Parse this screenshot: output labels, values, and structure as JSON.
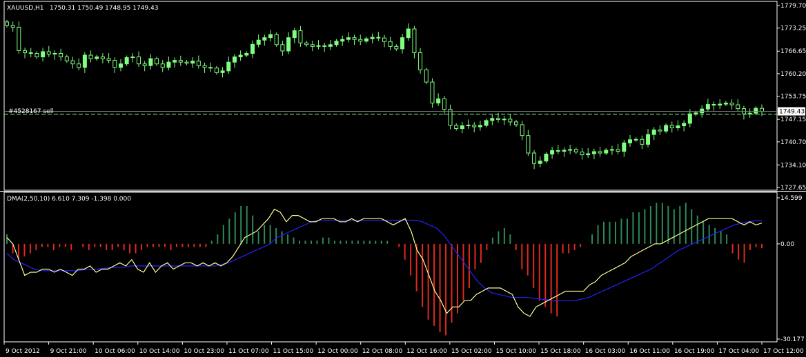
{
  "window": {
    "symbol_label": "XAUUSD,H1",
    "ohlc_text": "1750.31 1750.49 1748.95 1749.43",
    "order_label": "#4528167 sell",
    "current_price_label": "1749.43"
  },
  "indicator": {
    "label": "DMA(2,50,10) 6.610 7.309 -1.398 0.000"
  },
  "colors": {
    "background": "#000000",
    "grid_frame": "#ffffff",
    "bull_candle": "#7fff7f",
    "bear_candle": "#000000",
    "candle_outline": "#7fff7f",
    "order_line": "#7fff7f",
    "histogram_up": "#2e8b57",
    "histogram_down": "#e0281e",
    "dma_line": "#ffff99",
    "signal_line": "#2323ff",
    "text": "#ffffff"
  },
  "chart_data": [
    {
      "type": "candlestick",
      "title": "XAUUSD,H1",
      "price_axis_ticks": [
        "1779.70",
        "1773.25",
        "1766.65",
        "1760.20",
        "1753.75",
        "1747.15",
        "1740.70",
        "1734.10",
        "1727.65"
      ],
      "ylim": [
        1727.65,
        1779.7
      ],
      "time_labels": [
        "9 Oct 2012",
        "9 Oct 21:00",
        "10 Oct 06:00",
        "10 Oct 14:00",
        "10 Oct 23:00",
        "11 Oct 07:00",
        "11 Oct 15:00",
        "12 Oct 00:00",
        "12 Oct 08:00",
        "12 Oct 16:00",
        "15 Oct 02:00",
        "15 Oct 10:00",
        "15 Oct 18:00",
        "16 Oct 03:00",
        "16 Oct 11:00",
        "16 Oct 19:00",
        "17 Oct 04:00",
        "17 Oct 12:00"
      ],
      "order_line_price": 1748.6,
      "current_price": 1749.43,
      "close_series": [
        1774.0,
        1773.5,
        1766.8,
        1766.2,
        1766.0,
        1765.0,
        1766.5,
        1765.8,
        1766.0,
        1765.0,
        1763.9,
        1763.0,
        1762.0,
        1765.5,
        1764.5,
        1765.0,
        1764.5,
        1764.0,
        1762.0,
        1763.0,
        1764.8,
        1765.0,
        1763.0,
        1762.5,
        1764.5,
        1763.0,
        1762.0,
        1763.5,
        1764.0,
        1763.5,
        1763.2,
        1763.8,
        1762.5,
        1762.0,
        1761.8,
        1760.5,
        1761.0,
        1763.5,
        1765.0,
        1765.5,
        1766.0,
        1768.6,
        1769.8,
        1770.5,
        1771.4,
        1768.5,
        1766.7,
        1770.5,
        1772.5,
        1769.0,
        1768.5,
        1768.0,
        1768.2,
        1768.0,
        1768.5,
        1769.5,
        1770.0,
        1770.5,
        1770.0,
        1769.5,
        1770.2,
        1770.6,
        1770.4,
        1769.4,
        1768.0,
        1767.3,
        1770.5,
        1773.0,
        1766.2,
        1761.3,
        1757.8,
        1751.8,
        1753.0,
        1750.0,
        1745.4,
        1744.5,
        1745.3,
        1745.5,
        1745.0,
        1745.4,
        1746.8,
        1747.4,
        1747.1,
        1747.2,
        1746.4,
        1745.6,
        1742.5,
        1737.5,
        1734.5,
        1735.2,
        1737.2,
        1738.2,
        1738.0,
        1738.3,
        1738.5,
        1737.8,
        1737.0,
        1737.3,
        1737.9,
        1737.5,
        1738.3,
        1738.5,
        1738.0,
        1740.4,
        1741.3,
        1741.4,
        1740.0,
        1742.8,
        1744.1,
        1743.8,
        1745.4,
        1744.7,
        1745.3,
        1746.0,
        1748.7,
        1749.0,
        1750.1,
        1751.4,
        1751.2,
        1751.5,
        1751.8,
        1751.3,
        1750.2,
        1748.7,
        1748.9,
        1750.3,
        1749.43
      ]
    },
    {
      "type": "line",
      "title": "DMA(2,50,10) 6.610 7.309 -1.398 0.000",
      "indicator_axis_ticks": [
        "14.599",
        "0.00",
        "-30.177"
      ],
      "ylim": [
        -30.177,
        14.599
      ],
      "series": [
        {
          "name": "DMA",
          "values": [
            2,
            0,
            -5,
            -10,
            -9,
            -9,
            -8,
            -8,
            -9,
            -8,
            -9,
            -10,
            -8,
            -8,
            -7,
            -9,
            -8,
            -8,
            -7,
            -6,
            -7,
            -5,
            -8,
            -9,
            -6,
            -9,
            -7,
            -6,
            -8,
            -7,
            -6,
            -6,
            -7,
            -6,
            -7,
            -6,
            -7,
            -6,
            -4,
            -1,
            2,
            3,
            4,
            6,
            8,
            11,
            10,
            7,
            9,
            9,
            8,
            7,
            7,
            8,
            8,
            8,
            7,
            7,
            8,
            7,
            8,
            8,
            8,
            8,
            7,
            6,
            7,
            8,
            4,
            -2,
            -5,
            -10,
            -15,
            -18,
            -22,
            -20,
            -20,
            -18,
            -18,
            -16,
            -15,
            -14,
            -14,
            -14,
            -15,
            -16,
            -20,
            -22,
            -23,
            -20,
            -19,
            -18,
            -17,
            -16,
            -15,
            -15,
            -15,
            -15,
            -13,
            -12,
            -10,
            -9,
            -8,
            -7,
            -6,
            -4,
            -3,
            -2,
            -1,
            0,
            0,
            1,
            2,
            3,
            4,
            5,
            6,
            7,
            8,
            8,
            8,
            8,
            8,
            7,
            6,
            7,
            6,
            6.61
          ]
        },
        {
          "name": "Signal",
          "values": [
            -3,
            -5,
            -6,
            -7,
            -8,
            -8.5,
            -8.5,
            -8.5,
            -8.5,
            -8.5,
            -8.5,
            -8.3,
            -8,
            -8,
            -7.8,
            -7.5,
            -7.5,
            -7.3,
            -7,
            -7,
            -7,
            -7,
            -7,
            -7,
            -7,
            -7,
            -7,
            -7,
            -7,
            -7,
            -7,
            -6.5,
            -6,
            -5,
            -4,
            -3,
            -2,
            -1,
            0,
            2,
            3,
            4,
            5,
            6,
            7,
            7.5,
            7.5,
            7.5,
            7.5,
            7.5,
            7.5,
            7.5,
            7.5,
            7.5,
            7.5,
            7.5,
            7.5,
            7.5,
            7.5,
            7.5,
            7,
            6,
            5,
            3,
            0,
            -3,
            -6,
            -9,
            -12,
            -14,
            -15.5,
            -16,
            -16.5,
            -17,
            -17,
            -17,
            -17.2,
            -17.5,
            -17.7,
            -18,
            -18,
            -18,
            -18,
            -17.5,
            -17,
            -16,
            -15,
            -14,
            -13,
            -12,
            -11,
            -10,
            -9,
            -8,
            -6.5,
            -5,
            -3.5,
            -2,
            -1,
            0,
            1,
            2,
            3,
            4,
            5,
            6,
            6.5,
            7,
            7.3,
            7.309
          ]
        },
        {
          "name": "Histogram",
          "values": [
            3,
            -3,
            -5,
            -4,
            -3,
            -2,
            -1,
            -1,
            -2,
            -1,
            -1,
            -2,
            0,
            -1,
            -2,
            -1,
            -1,
            -2,
            -2,
            -1,
            -2,
            -3,
            -3,
            -2,
            -1,
            -1,
            -1,
            -1,
            -2,
            -1,
            -1,
            -1,
            -1,
            -1,
            -1,
            1,
            3,
            6,
            8,
            10,
            12,
            12,
            9,
            4,
            6,
            6,
            5,
            4,
            3,
            2,
            1,
            1,
            1,
            1,
            2,
            2,
            1,
            1,
            1,
            1,
            1,
            1,
            1,
            1,
            1,
            1,
            0,
            -1,
            -5,
            -10,
            -15,
            -20,
            -24,
            -26,
            -28,
            -29,
            -25,
            -22,
            -18,
            -14,
            -8,
            -6,
            -2,
            2,
            4,
            5,
            3,
            -2,
            -8,
            -10,
            -14,
            -18,
            -20,
            -22,
            -23,
            -3,
            -3,
            -2,
            -1,
            0,
            3,
            6,
            7,
            7,
            7,
            8,
            8,
            10,
            10,
            11,
            12,
            13,
            13,
            12,
            11,
            12,
            13,
            11,
            9,
            7,
            6,
            5,
            4,
            3,
            -3,
            -5,
            -6,
            -2,
            -1,
            -1.398
          ]
        }
      ]
    }
  ]
}
